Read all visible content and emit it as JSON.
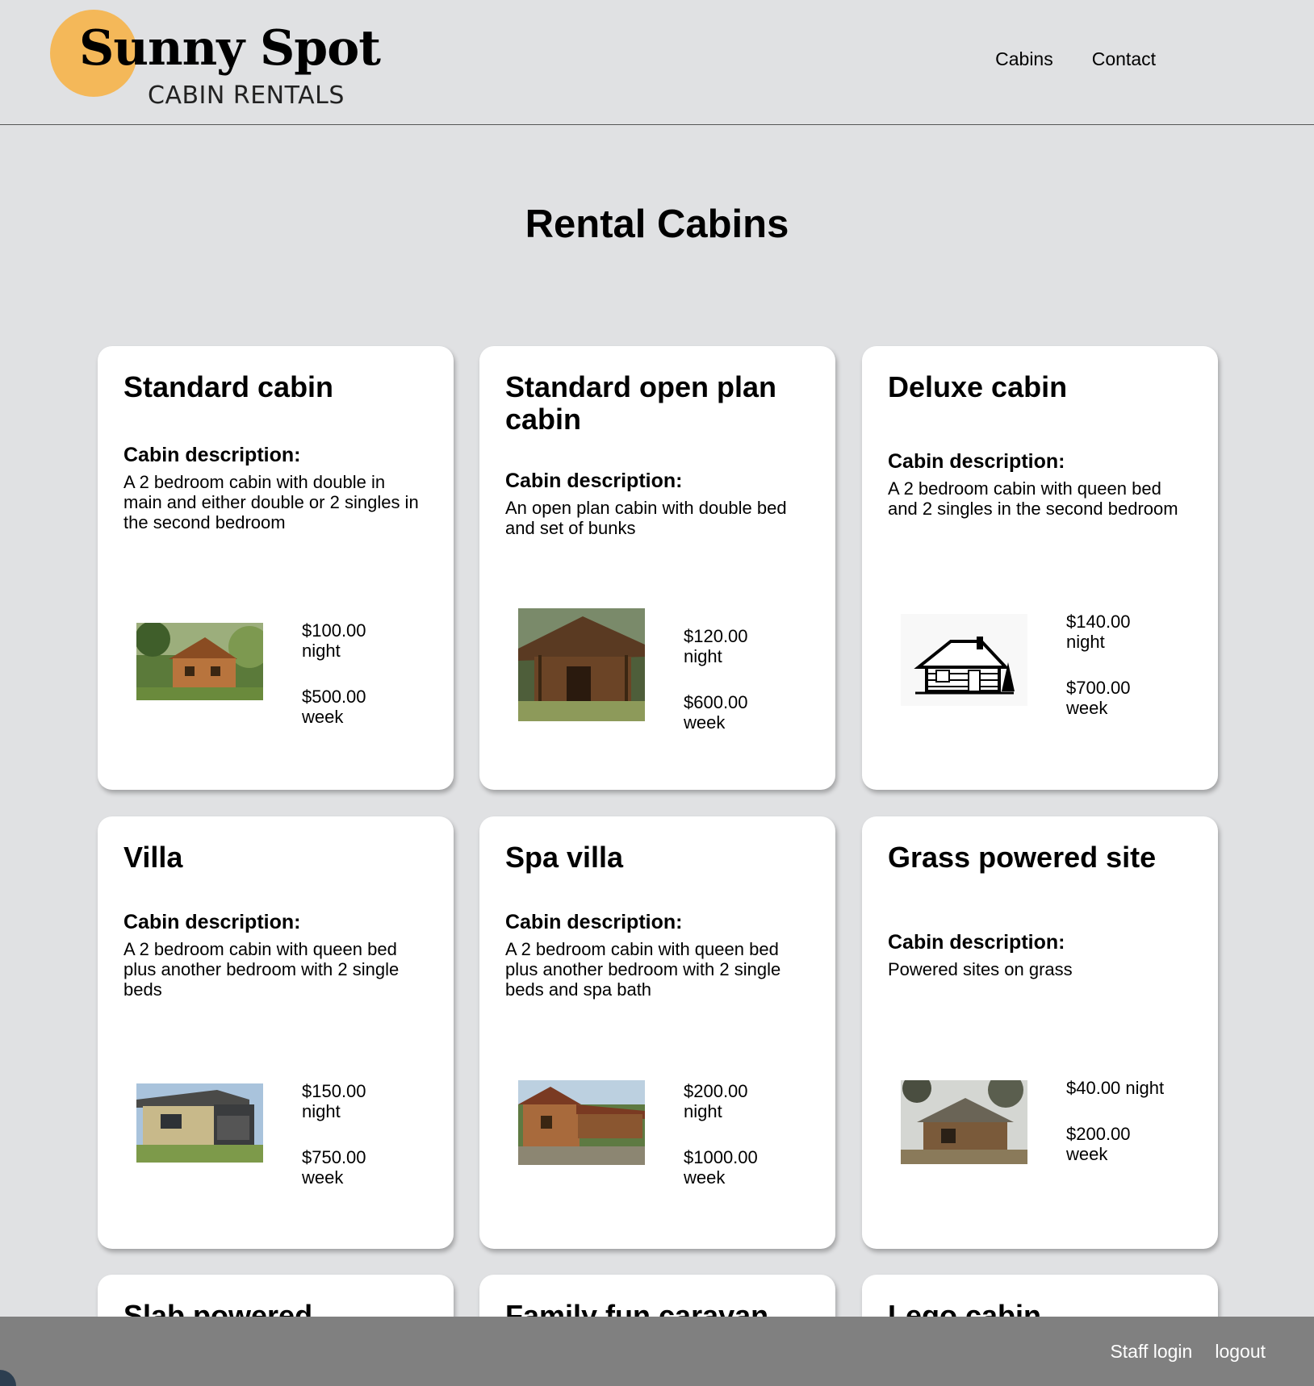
{
  "header": {
    "logo_title": "Sunny Spot",
    "logo_subtitle": "CABIN RENTALS",
    "nav": [
      {
        "label": "Cabins"
      },
      {
        "label": "Contact"
      }
    ]
  },
  "main": {
    "title": "Rental Cabins",
    "desc_label": "Cabin description:",
    "cabins": [
      {
        "name": "Standard cabin",
        "description": "A 2 bedroom cabin with double in main and either double or 2 singles in the second bedroom",
        "night_price": "$100.00",
        "night_unit": "night",
        "week_price": "$500.00",
        "week_unit": "week",
        "image_icon": "log-cabin-forest-photo"
      },
      {
        "name": "Standard open plan cabin",
        "description": "An open plan cabin with double bed and set of bunks",
        "night_price": "$120.00",
        "night_unit": "night",
        "week_price": "$600.00",
        "week_unit": "week",
        "image_icon": "timber-cabin-porch-photo"
      },
      {
        "name": "Deluxe cabin",
        "description": "A 2 bedroom cabin with queen bed and 2 singles in the second bedroom",
        "night_price": "$140.00",
        "night_unit": "night",
        "week_price": "$700.00",
        "week_unit": "week",
        "image_icon": "log-cabin-sketch"
      },
      {
        "name": "Villa",
        "description": "A 2 bedroom cabin with queen bed plus another bedroom with 2 single beds",
        "night_price": "$150.00",
        "night_unit": "night",
        "week_price": "$750.00",
        "week_unit": "week",
        "image_icon": "villa-photo"
      },
      {
        "name": "Spa villa",
        "description": "A 2 bedroom cabin with queen bed plus another bedroom with 2 single beds and spa bath",
        "night_price": "$200.00",
        "night_unit": "night",
        "week_price": "$1000.00",
        "week_unit": "week",
        "image_icon": "spa-villa-photo"
      },
      {
        "name": "Grass powered site",
        "description": "Powered sites on grass",
        "night_price": "$40.00 night",
        "night_unit": "",
        "week_price": "$200.00",
        "week_unit": "week",
        "image_icon": "grass-site-photo"
      },
      {
        "name": "Slab powered"
      },
      {
        "name": "Family fun caravan"
      },
      {
        "name": "Lego cabin"
      }
    ]
  },
  "footer": {
    "staff_login": "Staff login",
    "logout": "logout"
  },
  "colors": {
    "background": "#e0e1e3",
    "logo_sun": "#f4b859",
    "footer": "#808080",
    "card": "#ffffff"
  }
}
